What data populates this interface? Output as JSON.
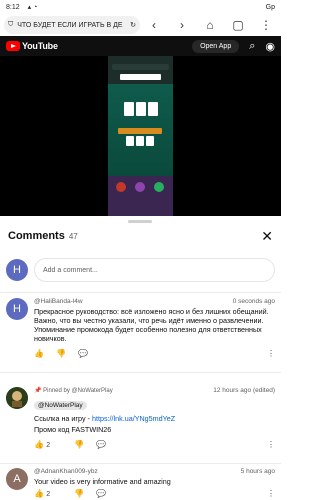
{
  "status": {
    "time": "8:12",
    "right": "Gp"
  },
  "browser": {
    "url_text": "ЧТО БУДЕТ ЕСЛИ ИГРАТЬ В ДЕ"
  },
  "youtube": {
    "logo_text": "YouTube",
    "open_app_label": "Open App"
  },
  "comments": {
    "title": "Comments",
    "count": "47",
    "add_avatar_letter": "H",
    "add_placeholder": "Add a comment...",
    "items": [
      {
        "author": "@HaliBanda-l4w",
        "time": "0 seconds ago",
        "avatar_letter": "H",
        "text": "Прекрасное руководство: всё изложено ясно и без лишних обещаний. Важно, что вы честно указали, что речь идёт именно о развлечении. Упоминание промокода будет особенно полезно для ответственных новичков.",
        "likes": ""
      },
      {
        "pinned_label": "Pinned by @NoWaterPlay",
        "author": "@NoWaterPlay",
        "time": "12 hours ago (edited)",
        "text_prefix": "Ссылка на игру - ",
        "link": "https://lnk.ua/YNg5mdYeZ",
        "text2": "Промо код FASTWIN26",
        "likes": "2"
      },
      {
        "author": "@AdnanKhan009-ybz",
        "time": "5 hours ago",
        "avatar_letter": "A",
        "text": "Your video is very informative and amazing",
        "likes": "2"
      }
    ]
  }
}
